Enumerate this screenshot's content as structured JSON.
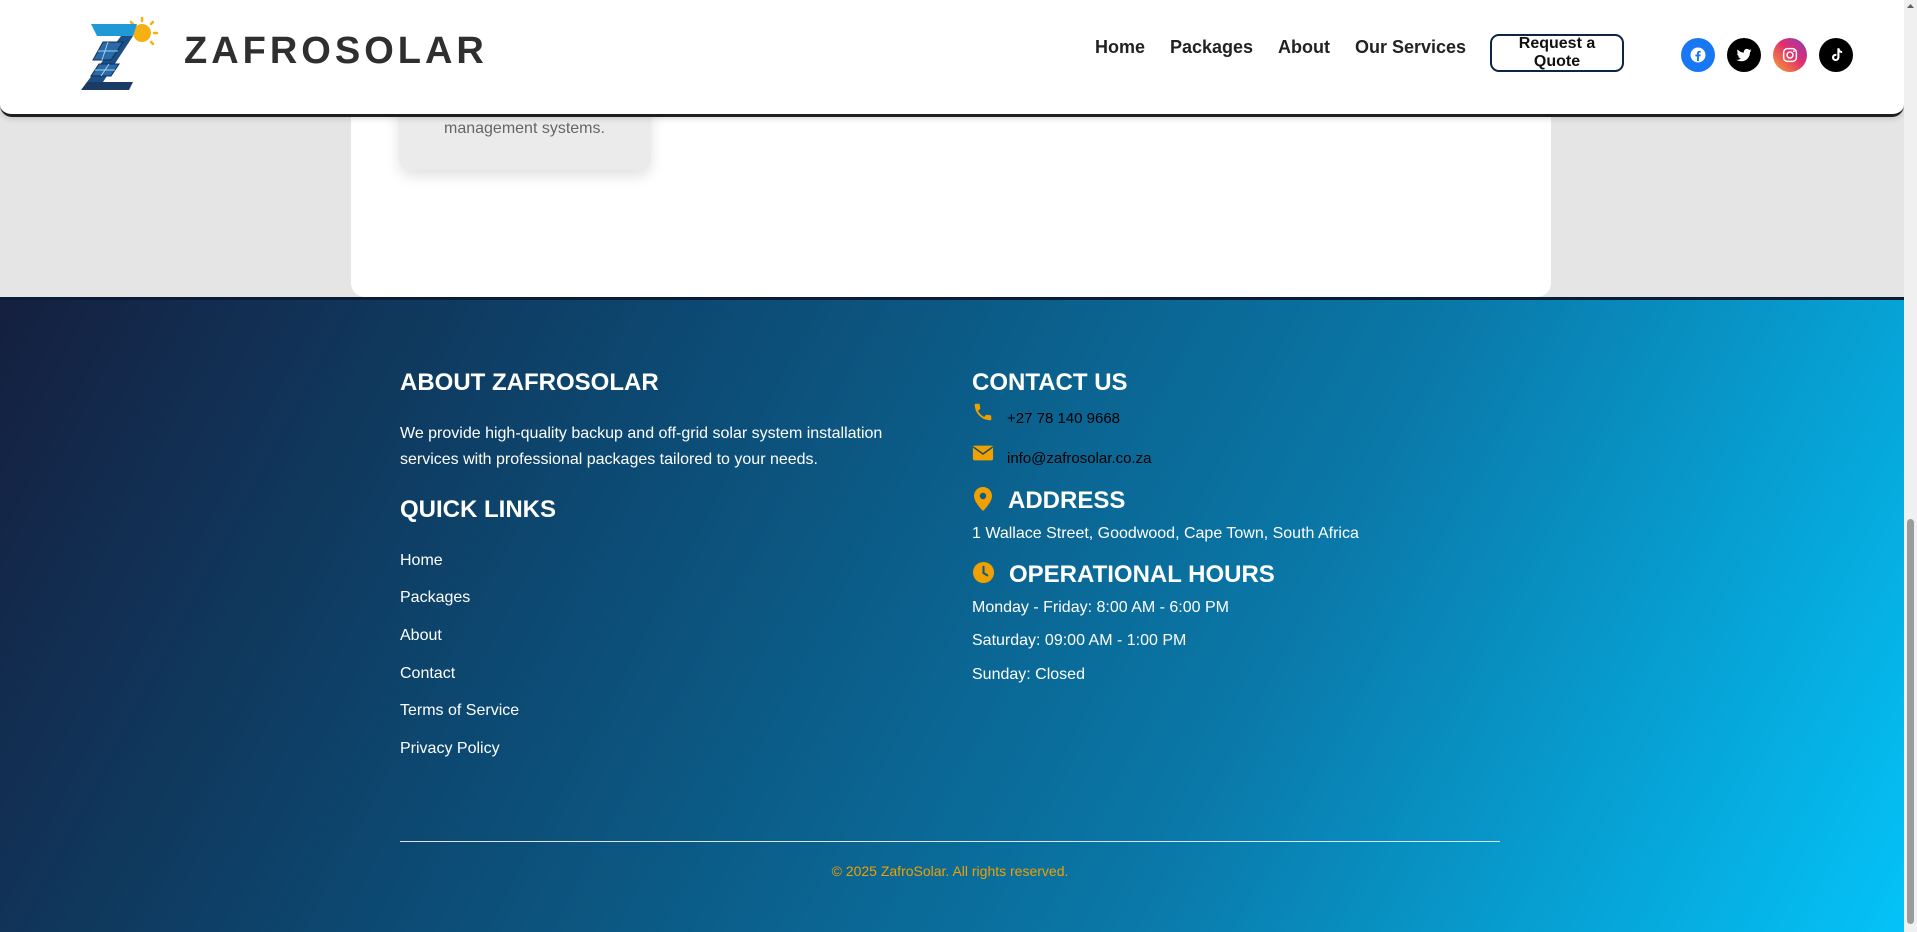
{
  "header": {
    "brand": "ZAFROSOLAR",
    "nav": [
      "Home",
      "Packages",
      "About",
      "Our Services"
    ],
    "quote_button": "Request a Quote",
    "social": [
      "facebook-icon",
      "twitter-icon",
      "instagram-icon",
      "tiktok-icon"
    ]
  },
  "service_card": {
    "description_tail": "management systems."
  },
  "footer": {
    "about": {
      "heading": "ABOUT ZAFROSOLAR",
      "text": "We provide high-quality backup and off-grid solar system installation services with professional packages tailored to your needs."
    },
    "quick_links": {
      "heading": "QUICK LINKS",
      "items": [
        "Home",
        "Packages",
        "About",
        "Contact",
        "Terms of Service",
        "Privacy Policy"
      ]
    },
    "contact": {
      "heading": "CONTACT US",
      "phone": "+27 78 140 9668",
      "email": "info@zafrosolar.co.za"
    },
    "address": {
      "heading": "ADDRESS",
      "text": "1 Wallace Street, Goodwood, Cape Town, South Africa"
    },
    "hours": {
      "heading": "OPERATIONAL HOURS",
      "lines": [
        "Monday - Friday: 8:00 AM - 6:00 PM",
        "Saturday: 09:00 AM - 1:00 PM",
        "Sunday: Closed"
      ]
    },
    "copyright": "© 2025 ZafroSolar. All rights reserved."
  },
  "colors": {
    "accent": "#f0a000",
    "navy": "#0c2540",
    "facebook": "#1877f2",
    "instagram": "#e1306c"
  }
}
